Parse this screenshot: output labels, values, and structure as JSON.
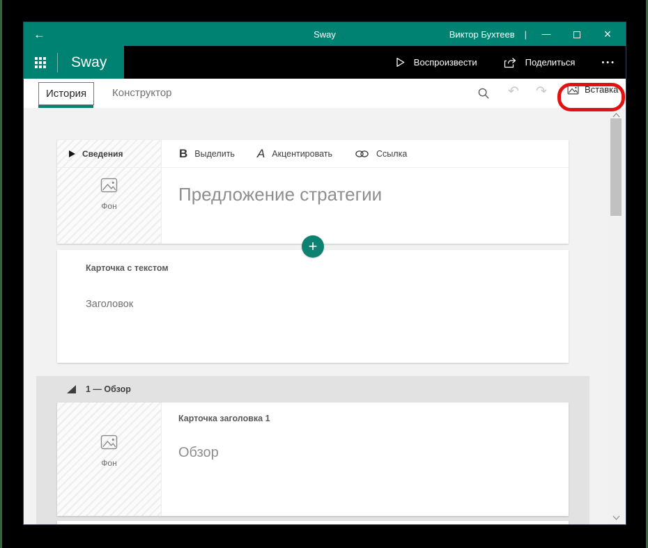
{
  "titlebar": {
    "back_glyph": "←",
    "app_title": "Sway",
    "user_name": "Виктор Бухтеев",
    "separator": "|",
    "minimize_glyph": "—",
    "close_glyph": "×"
  },
  "appbar": {
    "logo": "Sway",
    "play_label": "Воспроизвести",
    "share_label": "Поделиться",
    "more_glyph": "•••"
  },
  "tabbar": {
    "tabs": [
      {
        "label": "История",
        "active": true
      },
      {
        "label": "Конструктор",
        "active": false
      }
    ],
    "insert_label": "Вставка"
  },
  "storyline": {
    "details_label": "Сведения",
    "toolbar": {
      "bold_glyph": "B",
      "bold_label": "Выделить",
      "accent_glyph": "A",
      "accent_label": "Акцентировать",
      "link_label": "Ссылка"
    },
    "title_card": {
      "background_label": "Фон",
      "title_text": "Предложение стратегии"
    },
    "add_glyph": "+",
    "text_card": {
      "type_label": "Карточка с текстом",
      "body_text": "Заголовок"
    },
    "section": {
      "header_label": "1 — Обзор",
      "heading_card": {
        "type_label": "Карточка заголовка 1",
        "background_label": "Фон",
        "body_text": "Обзор"
      }
    }
  },
  "colors": {
    "brand_teal": "#008272",
    "topbar_black": "#000000",
    "content_bg": "#f2f2f2",
    "section_bg": "#e2e2e2",
    "annotation_red": "#e01310",
    "scroll_thumb": "#c1c1c1"
  }
}
